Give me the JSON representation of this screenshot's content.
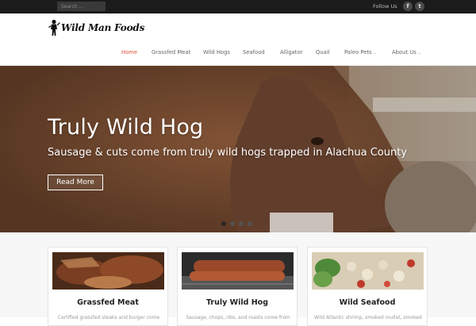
{
  "topbar": {
    "search_placeholder": "Search ...",
    "follow_label": "Follow Us",
    "social": [
      {
        "name": "facebook-icon",
        "glyph": "f"
      },
      {
        "name": "twitter-icon",
        "glyph": "t"
      }
    ]
  },
  "header": {
    "logo_text": "Wild Man Foods",
    "nav": [
      {
        "label": "Home",
        "active": true
      },
      {
        "label": "Grassfed Meat"
      },
      {
        "label": "Wild Hogs"
      },
      {
        "label": "Seafood"
      },
      {
        "label": "Alligator"
      },
      {
        "label": "Quail"
      },
      {
        "label": "Paleo Pets",
        "dropdown": true
      },
      {
        "label": "About Us",
        "dropdown": true
      }
    ]
  },
  "hero": {
    "title": "Truly Wild Hog",
    "subtitle": "Sausage & cuts come from truly wild hogs trapped in Alachua County",
    "button": "Read More",
    "slides": 4,
    "active_slide": 1
  },
  "cards": [
    {
      "title": "Grassfed Meat",
      "excerpt": "Certified grassfed steaks and burger come"
    },
    {
      "title": "Truly Wild Hog",
      "excerpt": "Sausage, chops, ribs, and roasts come from"
    },
    {
      "title": "Wild Seafood",
      "excerpt": "Wild Atlantic shrimp, smoked mullet, smoked"
    }
  ],
  "colors": {
    "accent": "#e0523a",
    "topbar": "#1b1b1b"
  }
}
